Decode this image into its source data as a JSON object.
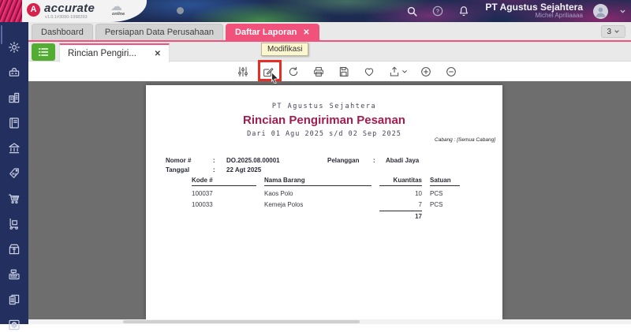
{
  "header": {
    "logo_text": "accurate",
    "logo_badge": "online",
    "logo_letter": "A",
    "version": "v1.0.1#3090-1998293",
    "company_name": "PT Agustus Sejahtera",
    "user_name": "Michel Apriliaaaa"
  },
  "icons": {
    "close": "✕",
    "cloud": "☁",
    "help": "?"
  },
  "tab_bar": {
    "tabs": [
      {
        "label": "Dashboard"
      },
      {
        "label": "Persiapan Data Perusahaan"
      },
      {
        "label": "Daftar Laporan"
      }
    ],
    "overflow_count": "3"
  },
  "document_tab": {
    "label": "Rincian Pengiri..."
  },
  "tooltip": {
    "text": "Modifikasi"
  },
  "toolbar": {
    "icons": [
      "filter-settings",
      "modify",
      "refresh",
      "print",
      "save",
      "favorite",
      "export",
      "zoom-in",
      "zoom-out"
    ]
  },
  "sidebar": {
    "icons": [
      "gear",
      "scale",
      "buildings",
      "ledger-book",
      "bank",
      "price-tag",
      "shopping-cart",
      "hand-truck",
      "package",
      "cash-register",
      "tax-documents",
      "globe-report"
    ]
  },
  "report": {
    "company": "PT Agustus Sejahtera",
    "title": "Rincian Pengiriman Pesanan",
    "period": "Dari 01 Agu 2025 s/d 02 Sep 2025",
    "branch_note": "Cabang : [Semua Cabang]",
    "fields": {
      "nomor_label": "Nomor #",
      "colon": ":",
      "nomor_value": "DO.2025.08.00001",
      "tanggal_label": "Tanggal",
      "tanggal_value": "22 Agt 2025",
      "pelanggan_label": "Pelanggan",
      "pelanggan_value": "Abadi Jaya"
    },
    "table": {
      "headers": [
        "Kode #",
        "Nama Barang",
        "Kuantitas",
        "Satuan"
      ],
      "rows": [
        {
          "kode": "100037",
          "nama": "Kaos Polo",
          "kuantitas": "10",
          "satuan": "PCS"
        },
        {
          "kode": "100033",
          "nama": "Kemeja Polos",
          "kuantitas": "7",
          "satuan": "PCS"
        }
      ],
      "total_kuantitas": "17"
    }
  },
  "colors": {
    "accent_pink": "#f0527b",
    "header_navy": "#1d2b52",
    "sidebar_navy": "#232f5e",
    "green_button": "#54ad33",
    "title_maroon": "#a31c4f",
    "highlight_red": "#e62e24",
    "tooltip_yellow": "#fcf7cf",
    "viewer_gray": "#6e6e6e"
  }
}
